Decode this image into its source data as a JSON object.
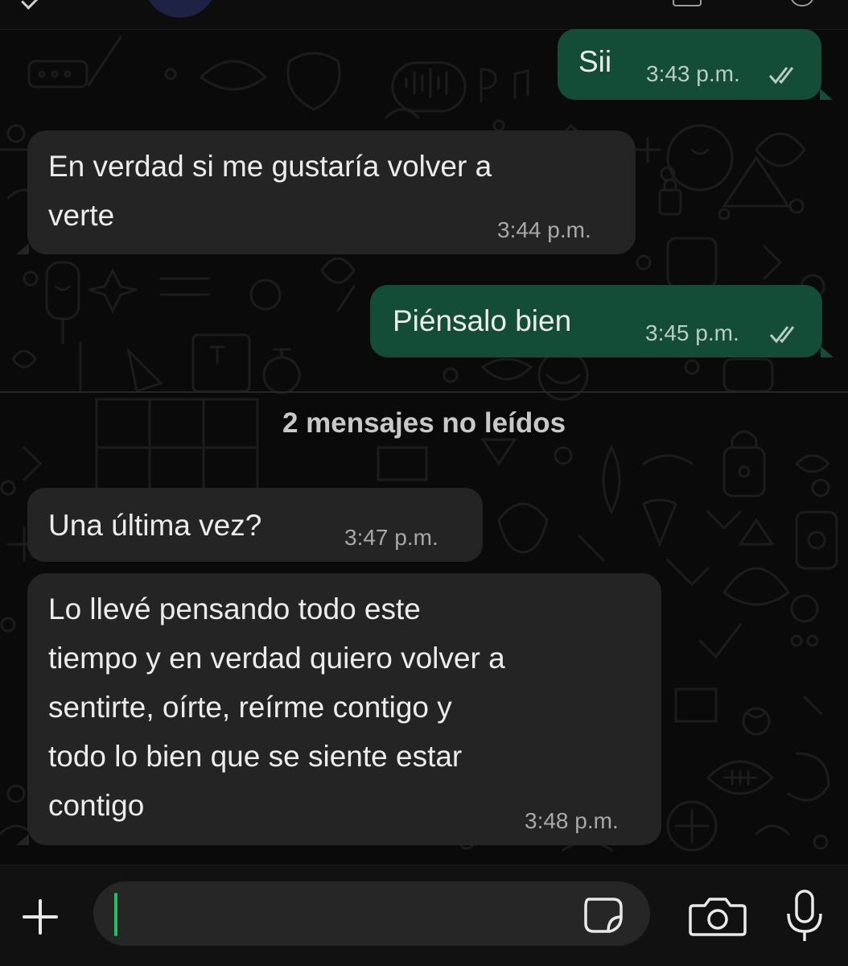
{
  "messages": [
    {
      "direction": "out",
      "text": "Sii",
      "time": "3:43 p.m.",
      "status": "read"
    },
    {
      "direction": "in",
      "text": "En verdad si me gustaría volver a\nverte",
      "time": "3:44 p.m."
    },
    {
      "direction": "out",
      "text": "Piénsalo bien",
      "time": "3:45 p.m.",
      "status": "read"
    },
    {
      "direction": "in",
      "text": "Una última vez?",
      "time": "3:47 p.m."
    },
    {
      "direction": "in",
      "text": "Lo llevé pensando todo este\ntiempo y en verdad quiero volver a\nsentirte, oírte, reírme contigo y\ntodo lo bien que se siente estar\ncontigo",
      "time": "3:48 p.m."
    }
  ],
  "unread_divider": "2 mensajes no leídos",
  "composer": {
    "value": "",
    "caret_color": "#20c15f"
  },
  "icons": {
    "attach": "plus-icon",
    "sticker": "sticker-icon",
    "camera": "camera-icon",
    "microphone": "microphone-icon",
    "read_receipt": "double-check-icon"
  },
  "colors": {
    "background": "#0a0a0a",
    "incoming_bubble": "#242424",
    "outgoing_bubble": "#134d37",
    "text": "#ececec"
  }
}
